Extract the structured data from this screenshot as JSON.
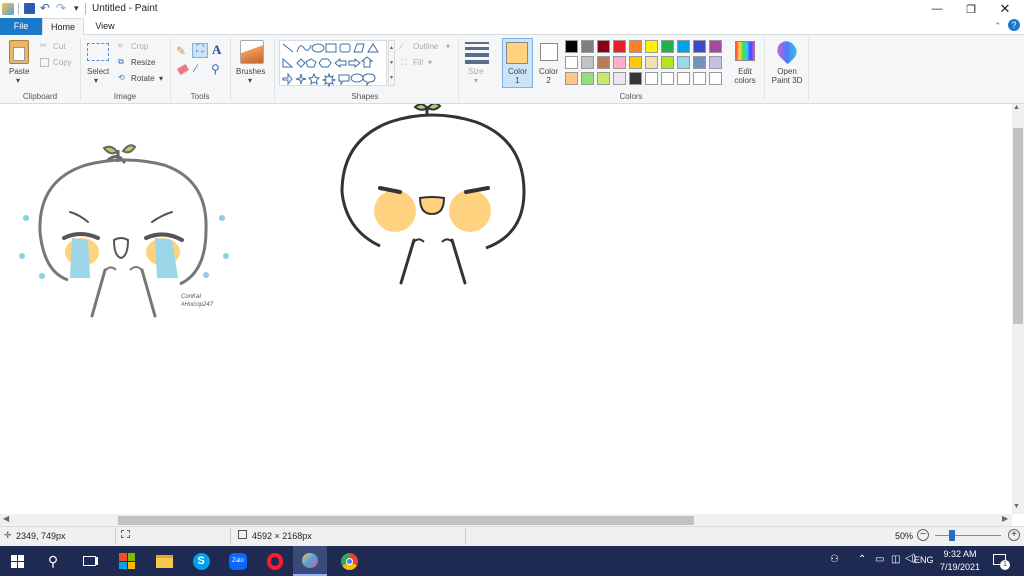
{
  "window": {
    "title": "Untitled - Paint"
  },
  "tabs": [
    {
      "label": "File"
    },
    {
      "label": "Home"
    },
    {
      "label": "View"
    }
  ],
  "clipboard": {
    "paste": "Paste",
    "cut": "Cut",
    "copy": "Copy",
    "group": "Clipboard"
  },
  "image": {
    "select": "Select",
    "crop": "Crop",
    "resize": "Resize",
    "rotate": "Rotate",
    "group": "Image"
  },
  "tools": {
    "group": "Tools"
  },
  "brushes": {
    "label": "Brushes"
  },
  "shapes": {
    "outline": "Outline",
    "fill": "Fill",
    "group": "Shapes"
  },
  "size": {
    "label": "Size"
  },
  "colors": {
    "color1": "Color\n1",
    "color2": "Color\n2",
    "edit": "Edit\ncolors",
    "open3d": "Open\nPaint 3D",
    "group": "Colors",
    "color1_value": "#ffd280",
    "palette_row1": [
      "#000000",
      "#7f7f7f",
      "#880015",
      "#ed1c24",
      "#ff7f27",
      "#fff200",
      "#22b14c",
      "#00a2e8",
      "#3f48cc",
      "#a349a4"
    ],
    "palette_row2": [
      "#ffffff",
      "#c3c3c3",
      "#b97a57",
      "#ffaec9",
      "#ffc90e",
      "#efe4b0",
      "#b5e61d",
      "#99d9ea",
      "#7092be",
      "#c8bfe7"
    ],
    "palette_row3": [
      "#ffc783",
      "#93e07a",
      "#c7ea6a",
      "#f1e4f2",
      "#353535",
      "#ffffff",
      "#ffffff",
      "#ffffff",
      "#ffffff",
      "#ffffff"
    ]
  },
  "drawing": {
    "signature_line1": "ConKat",
    "signature_line2": "#Hoicop247"
  },
  "status": {
    "cursor": "2349, 749px",
    "size": "4592 × 2168px",
    "zoom": "50%"
  },
  "taskbar": {
    "lang": "ENG",
    "time": "9:32 AM",
    "date": "7/19/2021",
    "notif_count": "1"
  }
}
